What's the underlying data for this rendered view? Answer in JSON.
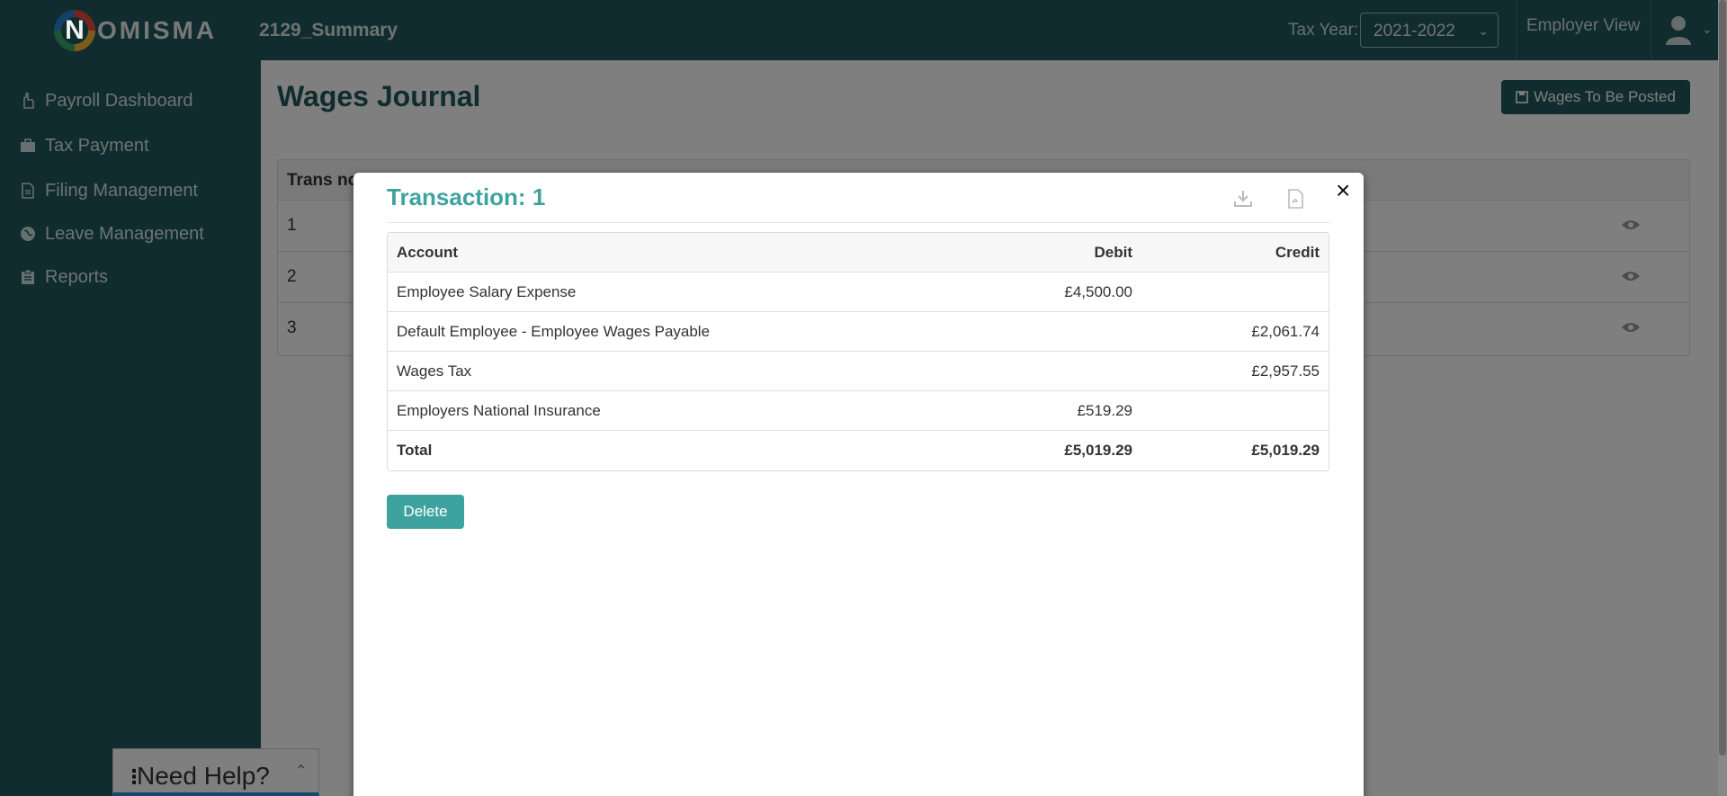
{
  "header": {
    "logo_text": "OMISMA",
    "logo_letter": "N",
    "company": "2129_Summary",
    "tax_year_label": "Tax Year:",
    "tax_year_value": "2021-2022",
    "employer_view": "Employer View"
  },
  "sidebar": {
    "items": [
      {
        "label": "Payroll Dashboard",
        "icon": "hand-icon"
      },
      {
        "label": "Tax Payment",
        "icon": "briefcase-icon"
      },
      {
        "label": "Filing Management",
        "icon": "document-icon"
      },
      {
        "label": "Leave Management",
        "icon": "globe-icon"
      },
      {
        "label": "Reports",
        "icon": "clipboard-icon"
      }
    ]
  },
  "main": {
    "title": "Wages Journal",
    "post_button": "Wages To Be Posted",
    "table": {
      "header": "Trans no",
      "rows": [
        "1",
        "2",
        "3"
      ]
    }
  },
  "modal": {
    "title": "Transaction: 1",
    "close": "×",
    "columns": {
      "account": "Account",
      "debit": "Debit",
      "credit": "Credit"
    },
    "rows": [
      {
        "account": "Employee Salary Expense",
        "debit": "£4,500.00",
        "credit": ""
      },
      {
        "account": "Default Employee - Employee Wages Payable",
        "debit": "",
        "credit": "£2,061.74"
      },
      {
        "account": "Wages Tax",
        "debit": "",
        "credit": "£2,957.55"
      },
      {
        "account": "Employers National Insurance",
        "debit": "£519.29",
        "credit": ""
      }
    ],
    "total": {
      "account": "Total",
      "debit": "£5,019.29",
      "credit": "£5,019.29"
    },
    "delete_button": "Delete"
  },
  "help": {
    "label": "Need Help?"
  },
  "colors": {
    "primary": "#22585c",
    "accent": "#3ea39e"
  }
}
